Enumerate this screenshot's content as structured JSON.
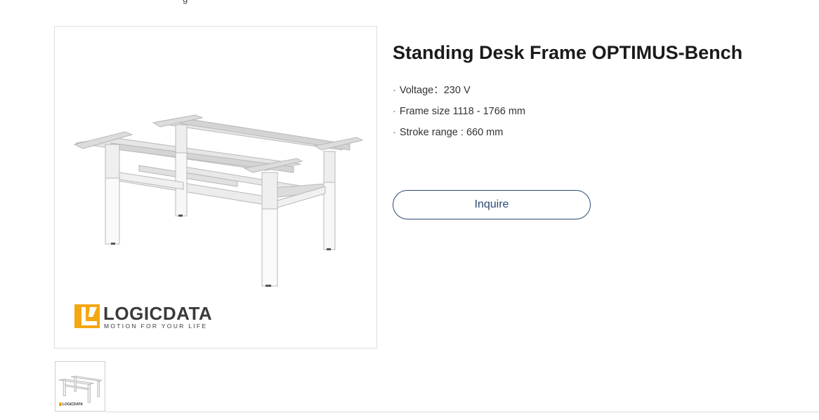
{
  "breadcrumb": {
    "text": "g"
  },
  "product": {
    "title": "Standing Desk Frame OPTIMUS-Bench",
    "specs": [
      {
        "bullet": "·",
        "text": "Voltage：230 V"
      },
      {
        "bullet": "·",
        "text": "Frame size 1118 - 1766 mm"
      },
      {
        "bullet": "·",
        "text": "Stroke range : 660 mm"
      }
    ],
    "inquire_label": "Inquire"
  },
  "image": {
    "logo_word": "LOGICDATA",
    "logo_tagline": "MOTION FOR YOUR LIFE",
    "thumb_logo_word": "LOGICDATA"
  },
  "colors": {
    "accent": "#2a4a72",
    "logo_orange": "#f3a712",
    "border": "#dedede"
  }
}
